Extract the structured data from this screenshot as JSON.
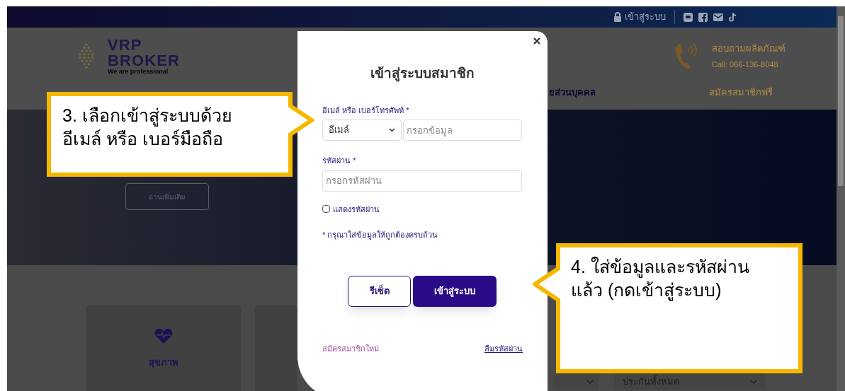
{
  "top_bar": {
    "login_link": "เข้าสู่ระบบ"
  },
  "header": {
    "logo": {
      "title_line_1": "VRP",
      "title_line_2": "BROKER",
      "tagline": "We are professional"
    },
    "contact": {
      "title": "สอบถามผลิตภัณฑ์",
      "phone": "Call: 066-136-8048"
    }
  },
  "nav": {
    "items": [
      {
        "label": "ยส่วนบุคคล"
      }
    ],
    "signup": "สมัครสมาชิกฟรี"
  },
  "hero": {
    "button": "อ่านเพิ่มเติม"
  },
  "categories": [
    {
      "label": "สุขภาพ"
    }
  ],
  "filter": {
    "value": "ประกันทั้งหมด"
  },
  "modal": {
    "title": "เข้าสู่ระบบสมาชิก",
    "identifier_label": "อีเมล์ หรือ เบอร์โทรศัพท์ *",
    "identifier_type": "อีเมล์",
    "identifier_placeholder": "กรอกข้อมูล",
    "password_label": "รหัสผ่าน *",
    "password_placeholder": "กรอกรหัสผ่าน",
    "show_password": {
      "label": "แสดงรหัสผ่าน",
      "checked": false
    },
    "note": "* กรุณาใส่ข้อมูลให้ถูกต้องครบถ้วน",
    "buttons": [
      {
        "kind": "reset",
        "label": "รีเซ็ต"
      },
      {
        "kind": "submit",
        "label": "เข้าสู่ระบบ"
      }
    ],
    "signup_link": "สมัครสมาชิกใหม่",
    "forgot_link": "ลืมรหัสผ่าน"
  },
  "callouts": [
    {
      "text": "3. เลือกเข้าสู่ระบบด้วย\nอีเมล์ หรือ เบอร์มือถือ"
    },
    {
      "text": "4. ใส่ข้อมูลและรหัสผ่าน\nแล้ว (กดเข้าสู่ระบบ)"
    }
  ]
}
